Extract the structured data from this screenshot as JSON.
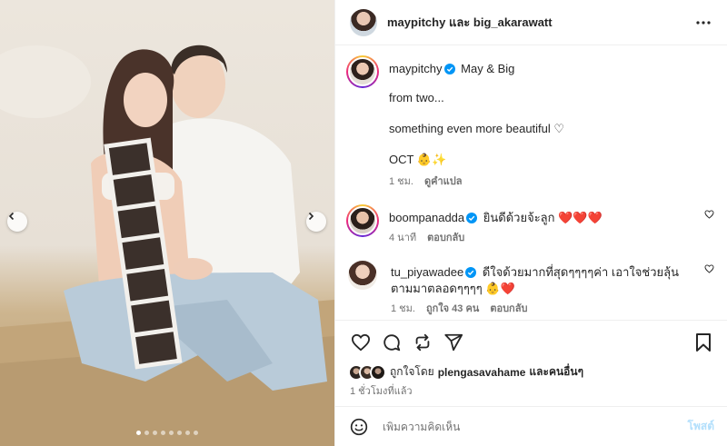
{
  "header": {
    "owner": "maypitchy",
    "and_word": "และ",
    "collaborator": "big_akarawatt",
    "more_icon": "more-horizontal-icon"
  },
  "caption": {
    "username": "maypitchy",
    "title": "May & Big",
    "lines": [
      "from two...",
      "something even more beautiful ♡",
      "OCT 👶✨"
    ],
    "time": "1 ชม.",
    "translate": "ดูคำแปล"
  },
  "comments": [
    {
      "username": "boompanadda",
      "text": "ยินดีด้วยจ้ะลูก ❤️❤️❤️",
      "time": "4 นาที",
      "likes": "",
      "reply": "ตอบกลับ"
    },
    {
      "username": "tu_piyawadee",
      "text": "ดีใจด้วยมากที่สุดๆๆๆๆค่า เอาใจช่วยลุ้นตามมาตลอดๆๆๆๆ 👶❤️",
      "time": "1 ชม.",
      "likes": "ถูกใจ 43 คน",
      "reply": "ตอบกลับ"
    }
  ],
  "likes": {
    "prefix": "ถูกใจโดย",
    "user": "plengasavahame",
    "suffix": "และคนอื่นๆ"
  },
  "time_ago": "1 ชั่วโมงที่แล้ว",
  "add_comment": {
    "placeholder": "เพิ่มความคิดเห็น",
    "post_label": "โพสต์"
  },
  "carousel": {
    "total": 8,
    "active_index": 0
  },
  "colors": {
    "verified": "#0095f6",
    "heart": "#ed4956",
    "post_disabled": "#b2dffc"
  }
}
